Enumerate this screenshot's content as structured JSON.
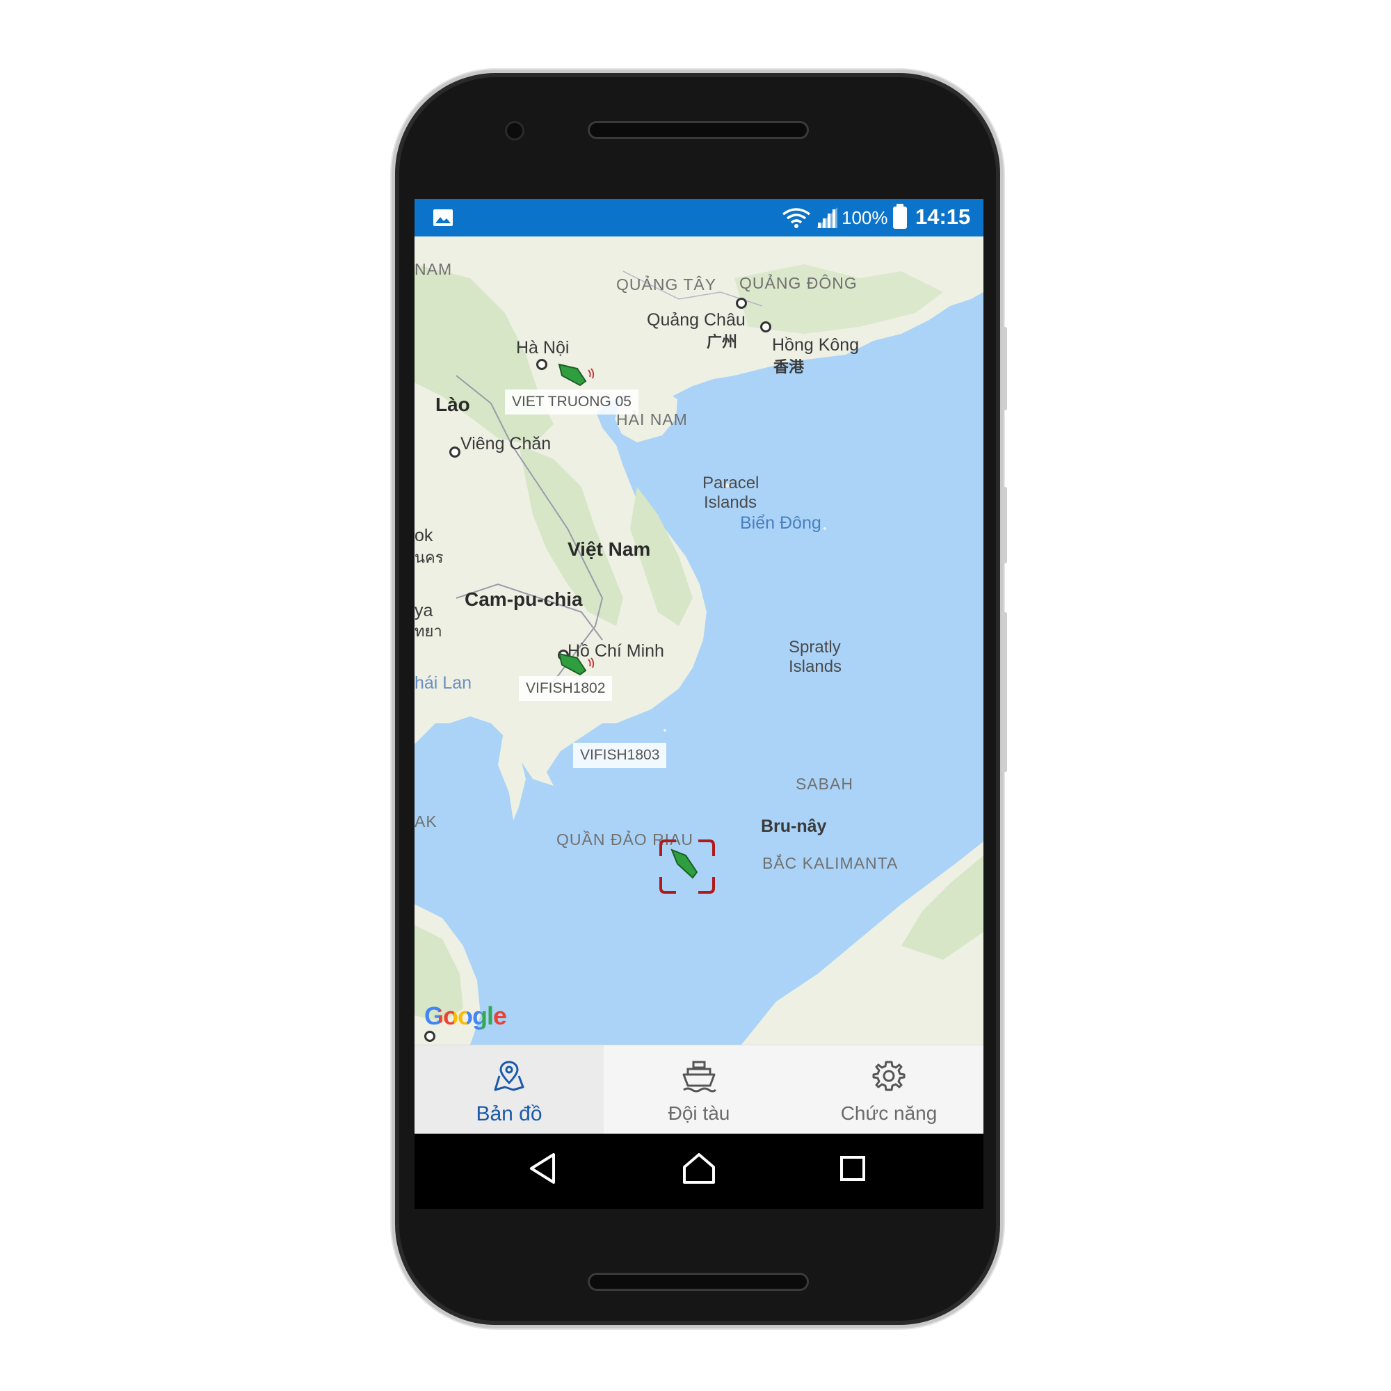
{
  "status_bar": {
    "battery_percent": "100%",
    "time": "14:15",
    "icons": [
      "gallery-icon",
      "wifi-icon",
      "signal-icon",
      "battery-icon"
    ]
  },
  "map": {
    "labels": {
      "nam": "NAM",
      "quang_tay": "QUẢNG TÂY",
      "quang_dong": "QUẢNG ĐÔNG",
      "quang_chau": "Quảng Châu",
      "quang_chau_cn": "广州",
      "hong_kong": "Hồng Kông",
      "hong_kong_cn": "香港",
      "ha_noi": "Hà Nội",
      "lao": "Lào",
      "hai_nam": "HẢI NAM",
      "vieng_chan": "Viêng Chăn",
      "paracel_1": "Paracel",
      "paracel_2": "Islands",
      "bien_dong": "Biển Đông",
      "ok": "ok",
      "thai_script": "นคร",
      "viet_nam": "Việt Nam",
      "campuchia": "Cam-pu-chia",
      "ya": "ya",
      "thai_script_2": "ทยา",
      "ho_chi_minh": "Hồ Chí Minh",
      "spratly_1": "Spratly",
      "spratly_2": "Islands",
      "thai_lan": "hái Lan",
      "sabah": "SABAH",
      "ak": "AK",
      "brunei": "Bru-nây",
      "quan_dao_riau": "QUẦN ĐẢO RIAU",
      "bac_kalimantan": "BẮC KALIMANTA"
    },
    "vessels": [
      {
        "name": "VIET TRUONG 05"
      },
      {
        "name": "VIFISH1802"
      },
      {
        "name": "VIFISH1803"
      }
    ],
    "attribution": "Google",
    "colors": {
      "water": "#aad3f7",
      "land": "#eef0e4",
      "forest": "#cfe3bf",
      "vessel": "#2e9e3e",
      "selection": "#b01a1a"
    }
  },
  "bottom_nav": {
    "items": [
      {
        "label": "Bản đồ",
        "icon": "map-pin-icon",
        "active": true
      },
      {
        "label": "Đội tàu",
        "icon": "ship-icon",
        "active": false
      },
      {
        "label": "Chức năng",
        "icon": "gear-icon",
        "active": false
      }
    ],
    "colors": {
      "active": "#1a5aa8",
      "inactive": "#6b6b6b"
    }
  },
  "system_nav": {
    "buttons": [
      "back-icon",
      "home-icon",
      "recents-icon"
    ]
  }
}
